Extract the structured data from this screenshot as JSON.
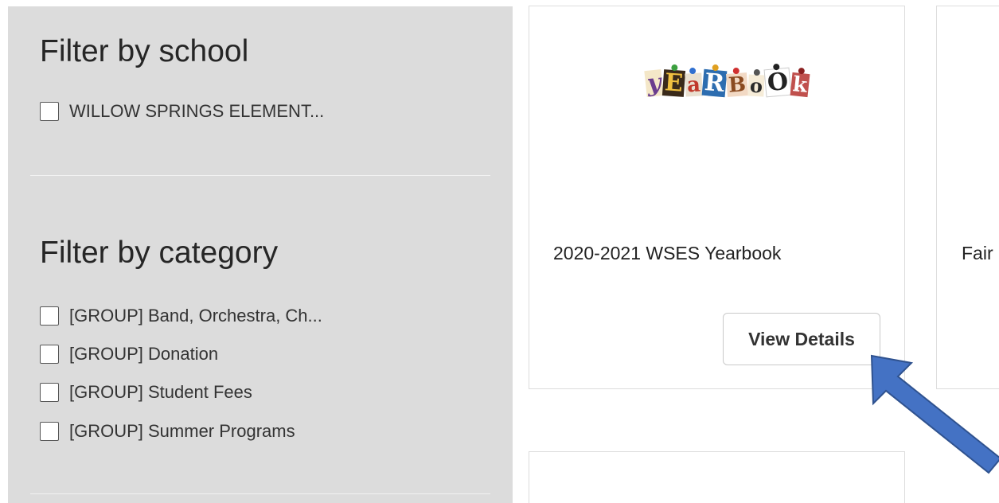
{
  "sidebar": {
    "school_title": "Filter by school",
    "schools": [
      {
        "label": "WILLOW SPRINGS ELEMENT..."
      }
    ],
    "category_title": "Filter by category",
    "categories": [
      {
        "label": "[GROUP] Band, Orchestra, Ch..."
      },
      {
        "label": "[GROUP] Donation"
      },
      {
        "label": "[GROUP] Student Fees"
      },
      {
        "label": "[GROUP] Summer Programs"
      }
    ]
  },
  "products": [
    {
      "title": "2020-2021 WSES Yearbook",
      "button_label": "View Details",
      "logo_letters": [
        "y",
        "E",
        "a",
        "R",
        "B",
        "o",
        "O",
        "k"
      ]
    },
    {
      "title": "Fair"
    }
  ],
  "colors": {
    "sidebar_bg": "#dcdcdc",
    "arrow": "#4472c4"
  }
}
